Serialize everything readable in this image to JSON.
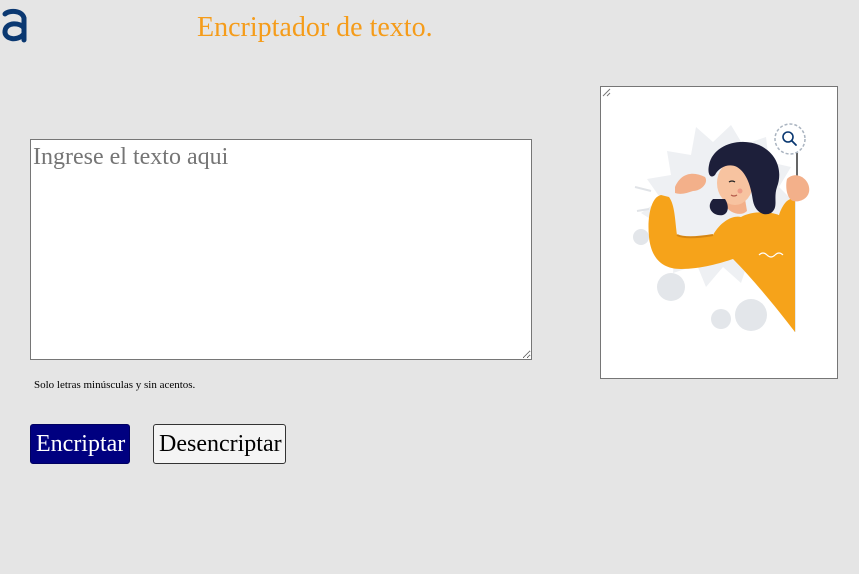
{
  "header": {
    "logo_icon": "alura-logo-icon",
    "title": "Encriptador de texto."
  },
  "input": {
    "placeholder": "Ingrese el texto aqui",
    "value": ""
  },
  "hint": {
    "text": "Solo letras minúsculas y sin acentos."
  },
  "buttons": {
    "encrypt_label": "Encriptar",
    "decrypt_label": "Desencriptar"
  },
  "output": {
    "illustration": "person-searching-illustration"
  },
  "colors": {
    "background": "#e5e5e5",
    "title": "#f59c1a",
    "encrypt_button": "#000080",
    "logo": "#0a3871"
  }
}
